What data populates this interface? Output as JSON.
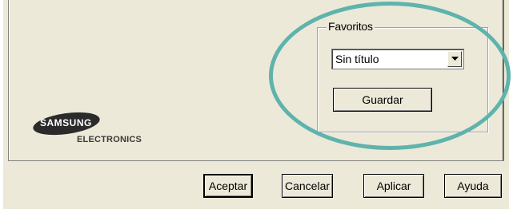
{
  "favorites": {
    "title": "Favoritos",
    "selected": "Sin título",
    "save_label": "Guardar"
  },
  "logo": {
    "brand": "SAMSUNG",
    "subtitle": "ELECTRONICS"
  },
  "footer": {
    "accept": "Aceptar",
    "cancel": "Cancelar",
    "apply": "Aplicar",
    "help": "Ayuda"
  },
  "colors": {
    "background": "#ece9d8",
    "highlight": "#5fb3ad"
  }
}
